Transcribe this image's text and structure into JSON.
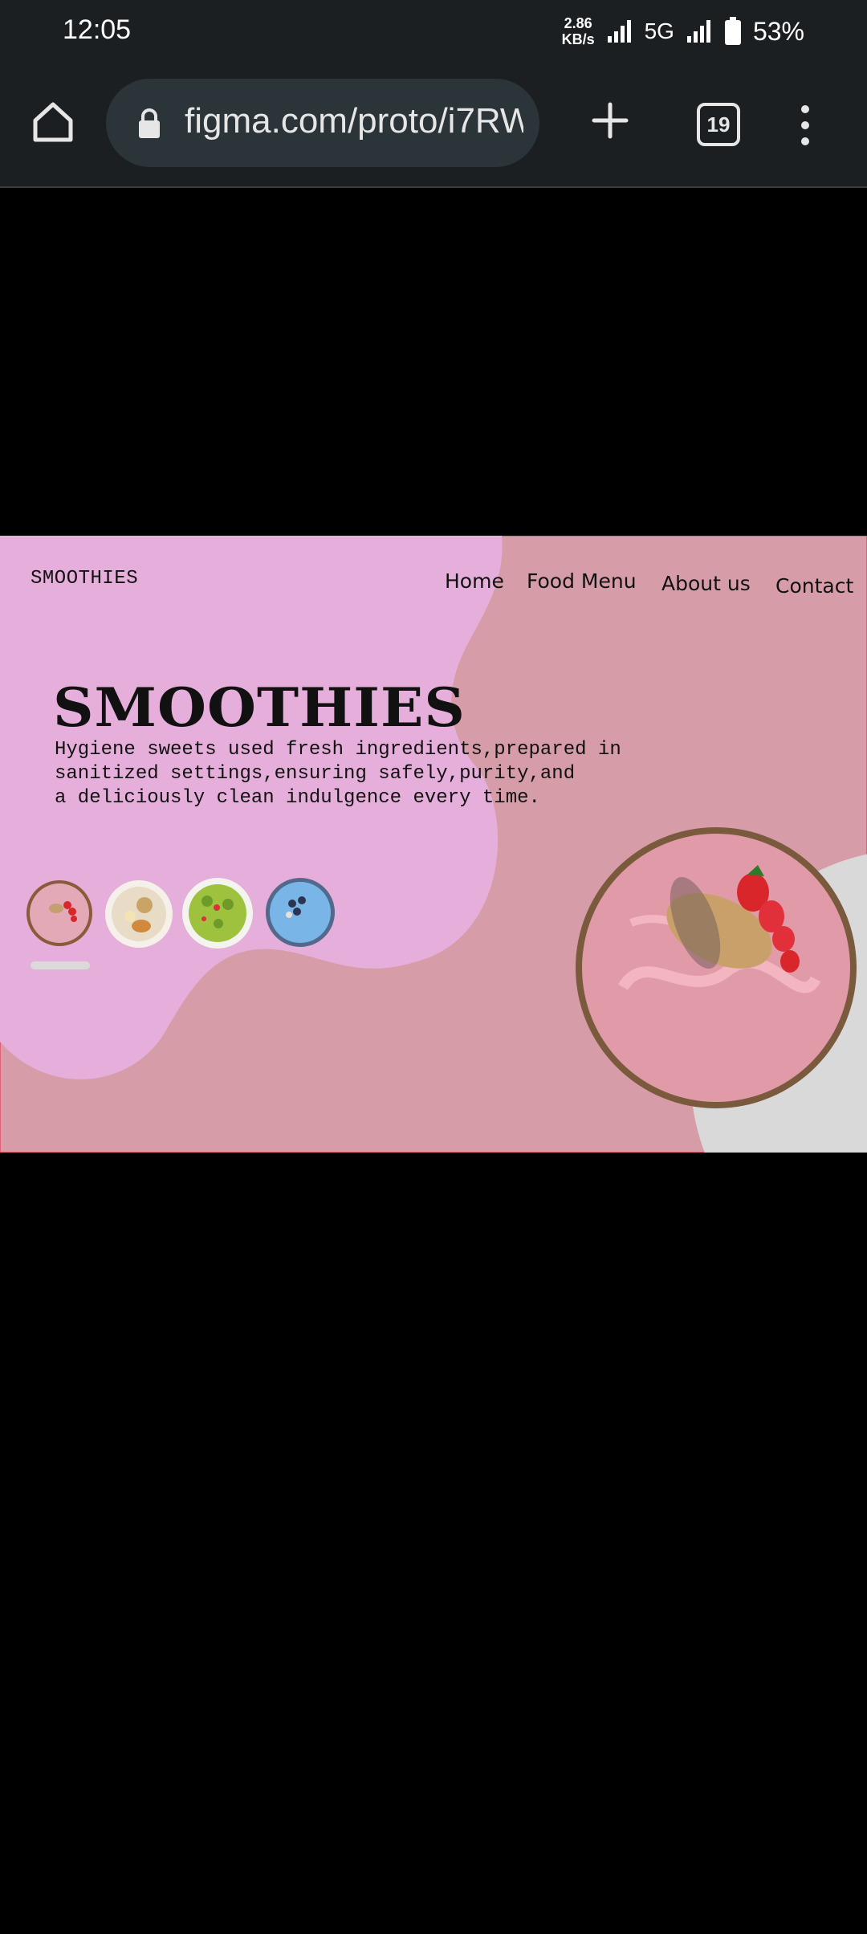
{
  "status_bar": {
    "time": "12:05",
    "net_speed_value": "2.86",
    "net_speed_unit": "KB/s",
    "network": "5G",
    "battery": "53%"
  },
  "browser": {
    "url": "figma.com/proto/i7RW",
    "tab_count": "19"
  },
  "page": {
    "logo": "SMOOTHIES",
    "nav": [
      "Home",
      "Food Menu",
      "About us",
      "Contact"
    ],
    "hero_title": "SMOOTHIES",
    "hero_description": [
      "Hygiene sweets used fresh ingredients,prepared in",
      "sanitized settings,ensuring safely,purity,and",
      "a deliciously clean indulgence every time."
    ],
    "thumbnails": [
      "strawberry-bowl",
      "banana-granola-bowl",
      "kiwi-green-bowl",
      "blueberry-bowl"
    ],
    "colors": {
      "background": "#d69ca8",
      "blob": "#e6aedb",
      "accent_arc": "#d9d9d9"
    }
  }
}
